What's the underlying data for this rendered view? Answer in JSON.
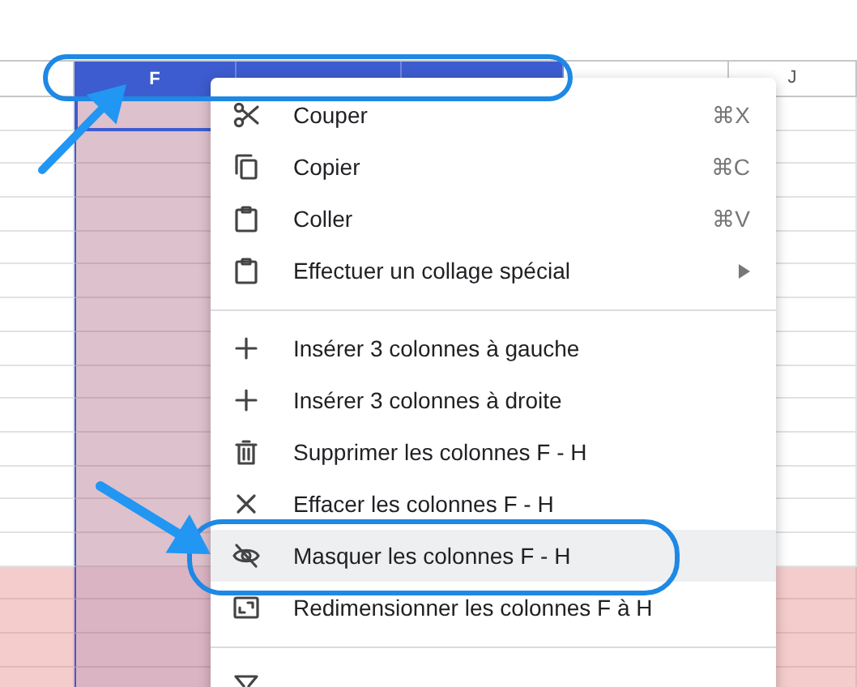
{
  "columns": [
    {
      "label": "F",
      "selected": true
    },
    {
      "selected": true
    },
    {
      "selected": true
    },
    {
      "selected": false
    },
    {
      "label": "J",
      "selected": false
    }
  ],
  "rows": [
    {
      "highlighted": false
    },
    {
      "highlighted": false
    },
    {
      "highlighted": false
    },
    {
      "highlighted": false
    },
    {
      "highlighted": false
    },
    {
      "highlighted": false
    },
    {
      "highlighted": false
    },
    {
      "highlighted": false
    },
    {
      "highlighted": false
    },
    {
      "highlighted": false
    },
    {
      "highlighted": false
    },
    {
      "highlighted": false
    },
    {
      "highlighted": false
    },
    {
      "highlighted": false
    },
    {
      "highlighted": true
    },
    {
      "highlighted": true
    },
    {
      "highlighted": true
    },
    {
      "highlighted": true
    }
  ],
  "context_menu": {
    "items": [
      {
        "kind": "item",
        "label": "Couper",
        "shortcut": "⌘X",
        "selected": false
      },
      {
        "kind": "item",
        "label": "Copier",
        "shortcut": "⌘C",
        "selected": false
      },
      {
        "kind": "item",
        "label": "Coller",
        "shortcut": "⌘V",
        "selected": false
      },
      {
        "kind": "item",
        "label": "Effectuer un collage spécial",
        "submenu": true,
        "selected": false
      },
      {
        "kind": "divider"
      },
      {
        "kind": "item",
        "label": "Insérer 3 colonnes à gauche",
        "selected": false
      },
      {
        "kind": "item",
        "label": "Insérer 3 colonnes à droite",
        "selected": false
      },
      {
        "kind": "item",
        "label": "Supprimer les colonnes F - H",
        "selected": false
      },
      {
        "kind": "item",
        "label": "Effacer les colonnes F - H",
        "selected": false
      },
      {
        "kind": "item",
        "label": "Masquer les colonnes F - H",
        "selected": true
      },
      {
        "kind": "item",
        "label": "Redimensionner les colonnes F à H",
        "selected": false
      },
      {
        "kind": "divider"
      },
      {
        "kind": "item",
        "selected": false
      }
    ]
  }
}
